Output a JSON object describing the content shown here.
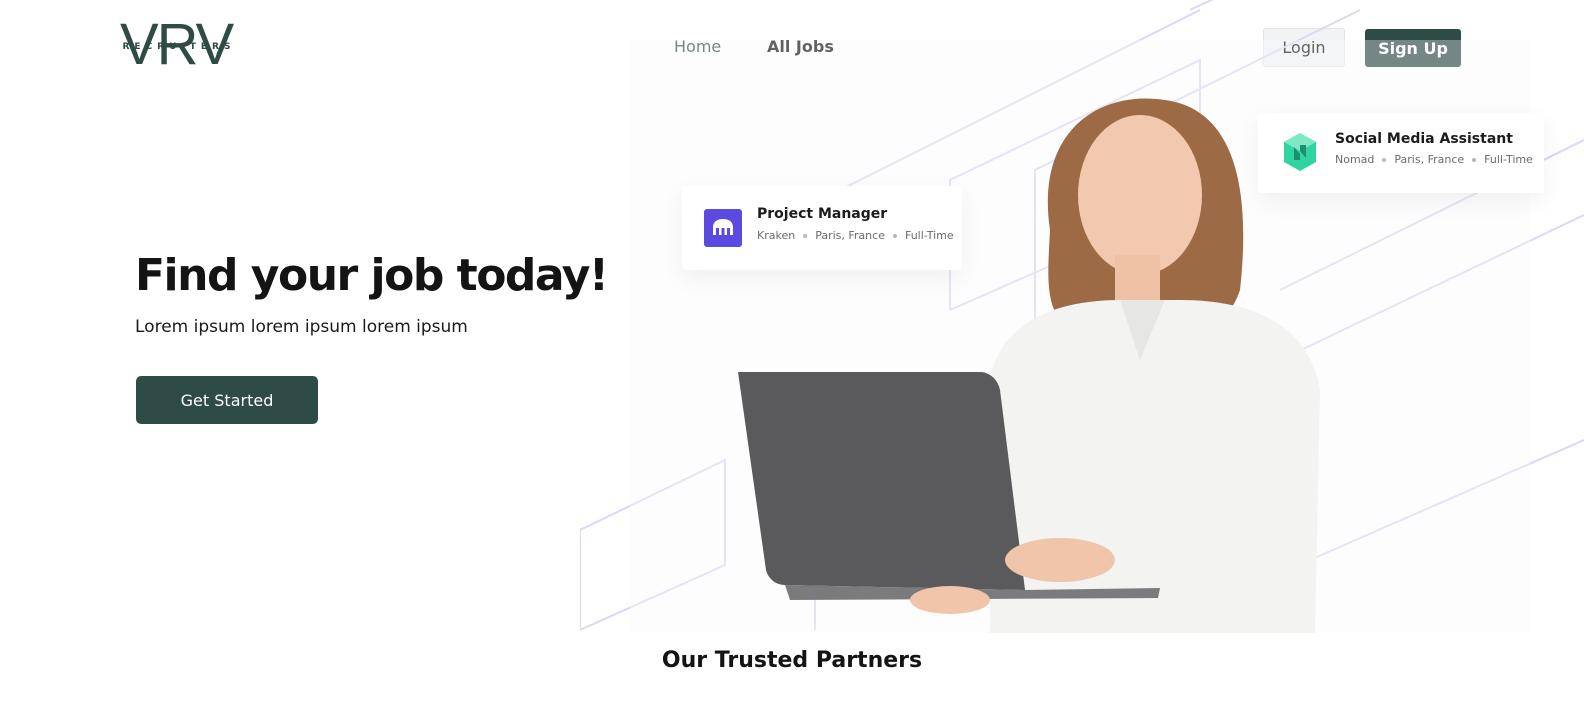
{
  "brand": {
    "logo_main": "VRV",
    "logo_sub": "RECRUITERS",
    "color": "#2f4b46"
  },
  "nav": {
    "links": [
      {
        "label": "Home"
      },
      {
        "label": "All Jobs"
      }
    ],
    "login_label": "Login",
    "signup_label": "Sign Up"
  },
  "hero": {
    "title": "Find your job today!",
    "subtitle": "Lorem ipsum lorem ipsum lorem ipsum",
    "cta_label": "Get Started"
  },
  "job_cards": [
    {
      "title": "Project Manager",
      "company": "Kraken",
      "location": "Paris, France",
      "type": "Full-Time",
      "logo_icon": "kraken-logo-icon",
      "logo_color": "#5b4ae0"
    },
    {
      "title": "Social Media Assistant",
      "company": "Nomad",
      "location": "Paris, France",
      "type": "Full-Time",
      "logo_icon": "nomad-logo-icon",
      "logo_color": "#2fd4a0"
    }
  ],
  "partners": {
    "heading": "Our Trusted Partners"
  }
}
